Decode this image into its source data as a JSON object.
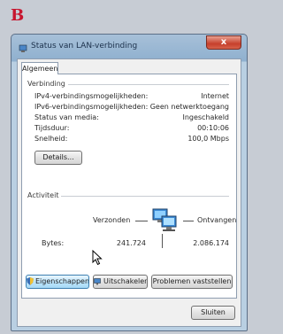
{
  "figure_label": "B",
  "window": {
    "title": "Status van LAN-verbinding",
    "close_glyph": "x"
  },
  "tab": {
    "label": "Algemeen"
  },
  "connection": {
    "section_label": "Verbinding",
    "rows": [
      {
        "label": "IPv4-verbindingsmogelijkheden:",
        "value": "Internet"
      },
      {
        "label": "IPv6-verbindingsmogelijkheden:",
        "value": "Geen netwerktoegang"
      },
      {
        "label": "Status van media:",
        "value": "Ingeschakeld"
      },
      {
        "label": "Tijdsduur:",
        "value": "00:10:06"
      },
      {
        "label": "Snelheid:",
        "value": "100,0 Mbps"
      }
    ],
    "details_button": "Details..."
  },
  "activity": {
    "section_label": "Activiteit",
    "sent_label": "Verzonden",
    "received_label": "Ontvangen",
    "bytes_label": "Bytes:",
    "bytes_sent": "241.724",
    "bytes_received": "2.086.174"
  },
  "buttons": {
    "properties": "Eigenschappen",
    "disable": "Uitschakelen",
    "diagnose": "Problemen vaststellen",
    "close": "Sluiten"
  },
  "icons": {
    "title": "network-icon",
    "activity": "network-computers-icon",
    "properties": "shield-icon",
    "disable": "network-disable-icon",
    "cursor": "mouse-pointer-icon"
  }
}
